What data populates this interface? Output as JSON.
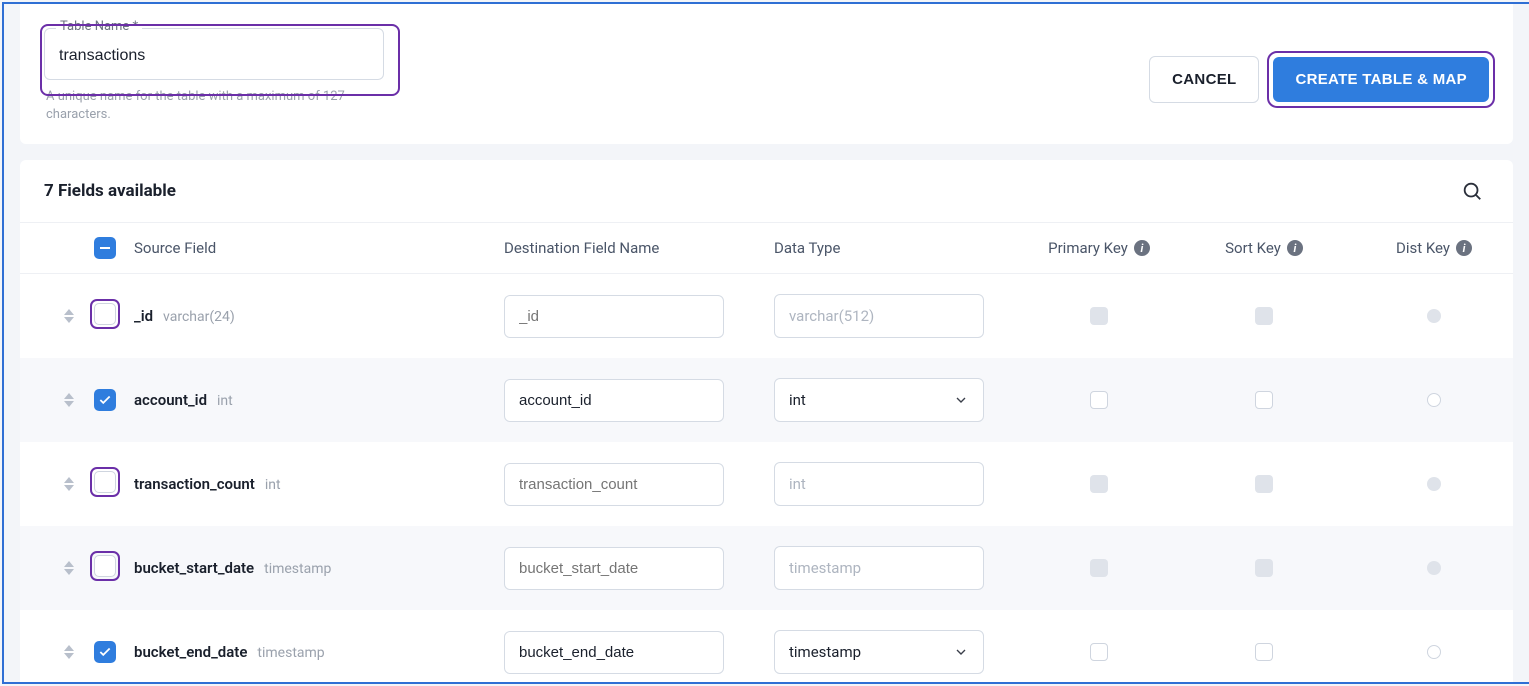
{
  "form": {
    "tableName": {
      "label": "Table Name *",
      "value": "transactions",
      "helper": "A unique name for the table with a maximum of 127 characters."
    },
    "actions": {
      "cancel": "CANCEL",
      "create": "CREATE TABLE & MAP"
    }
  },
  "fieldsSection": {
    "title": "7 Fields available",
    "columns": {
      "source": "Source Field",
      "dest": "Destination Field Name",
      "dtype": "Data Type",
      "pkey": "Primary Key",
      "sortkey": "Sort Key",
      "distkey": "Dist Key"
    },
    "rows": [
      {
        "checked": false,
        "highlighted": true,
        "name": "_id",
        "srcType": "varchar(24)",
        "dest": "_id",
        "dtype": "varchar(512)",
        "disabled": true,
        "pk": "sq-d",
        "sk": "sq-d",
        "dk": "circ-d"
      },
      {
        "checked": true,
        "highlighted": false,
        "name": "account_id",
        "srcType": "int",
        "dest": "account_id",
        "dtype": "int",
        "disabled": false,
        "pk": "sq-o",
        "sk": "sq-o",
        "dk": "circ-o"
      },
      {
        "checked": false,
        "highlighted": true,
        "name": "transaction_count",
        "srcType": "int",
        "dest": "transaction_count",
        "dtype": "int",
        "disabled": true,
        "pk": "sq-d",
        "sk": "sq-d",
        "dk": "circ-d"
      },
      {
        "checked": false,
        "highlighted": true,
        "name": "bucket_start_date",
        "srcType": "timestamp",
        "dest": "bucket_start_date",
        "dtype": "timestamp",
        "disabled": true,
        "pk": "sq-d",
        "sk": "sq-d",
        "dk": "circ-d"
      },
      {
        "checked": true,
        "highlighted": false,
        "name": "bucket_end_date",
        "srcType": "timestamp",
        "dest": "bucket_end_date",
        "dtype": "timestamp",
        "disabled": false,
        "pk": "sq-o",
        "sk": "sq-o",
        "dk": "circ-o"
      }
    ]
  }
}
